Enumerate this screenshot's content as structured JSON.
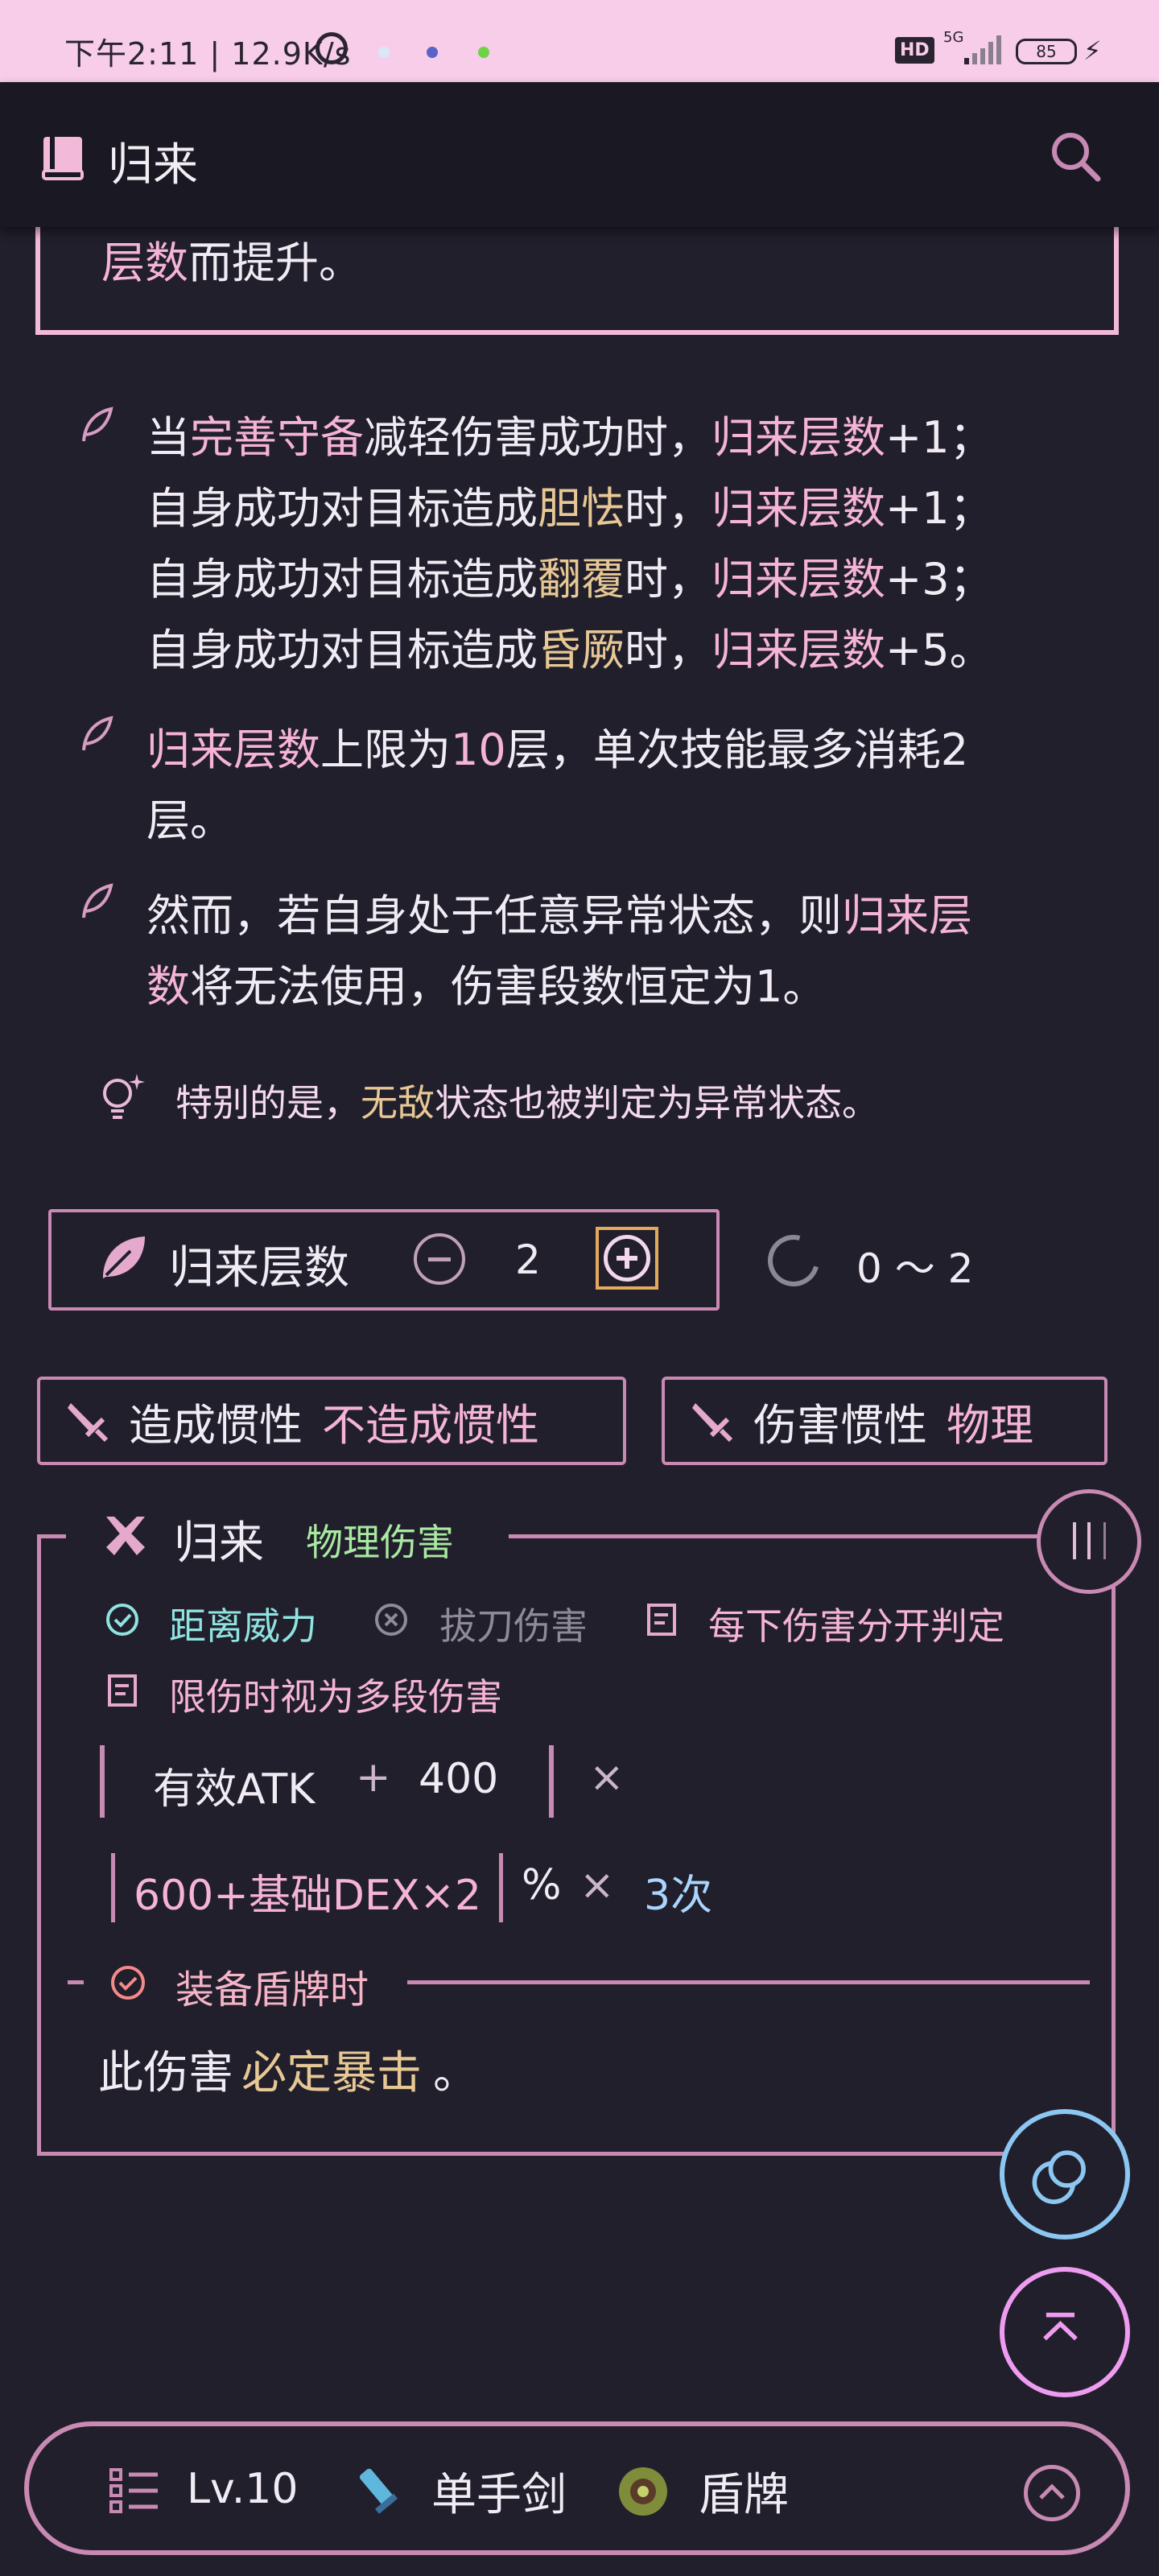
{
  "status_bar": {
    "time_speed": "下午2:11 | 12.9K/s",
    "hd": "HD",
    "network": "5G",
    "battery": "85"
  },
  "app_bar": {
    "title": "归来"
  },
  "intro": {
    "pink": "层数",
    "rest": "而提升。"
  },
  "rules": [
    {
      "lines": [
        [
          [
            "当",
            ""
          ],
          [
            "完善守备",
            "pink"
          ],
          [
            "减轻伤害成功时，",
            ""
          ],
          [
            "归来层数",
            "pink"
          ],
          [
            "+1；",
            ""
          ]
        ],
        [
          [
            "自身成功对目标造成",
            ""
          ],
          [
            "胆怯",
            "gold"
          ],
          [
            "时，",
            ""
          ],
          [
            "归来层数",
            "pink"
          ],
          [
            "+1；",
            ""
          ]
        ],
        [
          [
            "自身成功对目标造成",
            ""
          ],
          [
            "翻覆",
            "gold"
          ],
          [
            "时，",
            ""
          ],
          [
            "归来层数",
            "pink"
          ],
          [
            "+3；",
            ""
          ]
        ],
        [
          [
            "自身成功对目标造成",
            ""
          ],
          [
            "昏厥",
            "gold"
          ],
          [
            "时，",
            ""
          ],
          [
            "归来层数",
            "pink"
          ],
          [
            "+5。",
            ""
          ]
        ]
      ]
    },
    {
      "lines": [
        [
          [
            "归来层数",
            "pink"
          ],
          [
            "上限为",
            ""
          ],
          [
            "10",
            "pink"
          ],
          [
            "层，单次技能最多消耗2",
            ""
          ]
        ],
        [
          [
            "层。",
            ""
          ]
        ]
      ]
    },
    {
      "lines": [
        [
          [
            "然而，若自身处于任意异常状态，则",
            ""
          ],
          [
            "归来层",
            "pink"
          ]
        ],
        [
          [
            "数",
            "pink"
          ],
          [
            "将无法使用，伤害段数恒定为1。",
            ""
          ]
        ]
      ]
    }
  ],
  "tip": {
    "prefix": "特别的是，",
    "highlight": "无敌",
    "suffix": "状态也被判定为异常状态。"
  },
  "stacks": {
    "label": "归来层数",
    "value": "2",
    "range": "0 ～ 2"
  },
  "chips": {
    "inertia_label": "造成惯性",
    "inertia_value": "不造成惯性",
    "damage_inertia_label": "伤害惯性",
    "damage_inertia_value": "物理"
  },
  "damage_card": {
    "title": "归来",
    "type": "物理伤害",
    "options": {
      "distance": "距离威力",
      "unsheathe": "拔刀伤害",
      "separate": "每下伤害分开判定",
      "multi": "限伤时视为多段伤害"
    },
    "formula1": {
      "term": "有效ATK",
      "plus": "+",
      "constant": "400",
      "times": "×"
    },
    "formula2": {
      "term": "600+基础DEX×2",
      "unit": "%",
      "times": "×",
      "hits": "3次"
    },
    "condition": {
      "label": "装备盾牌时",
      "text_prefix": "此伤害",
      "text_highlight": "必定暴击",
      "text_suffix": "。"
    }
  },
  "bottom_bar": {
    "level": "Lv.10",
    "main_weapon": "单手剑",
    "sub_weapon": "盾牌"
  },
  "colors": {
    "background": "#211f2c",
    "accent_pink": "#f5b3d6",
    "accent_gold": "#e7c895",
    "accent_green": "#a9e9a1",
    "status_bar": "#f7cdea",
    "border": "#c889b3"
  }
}
